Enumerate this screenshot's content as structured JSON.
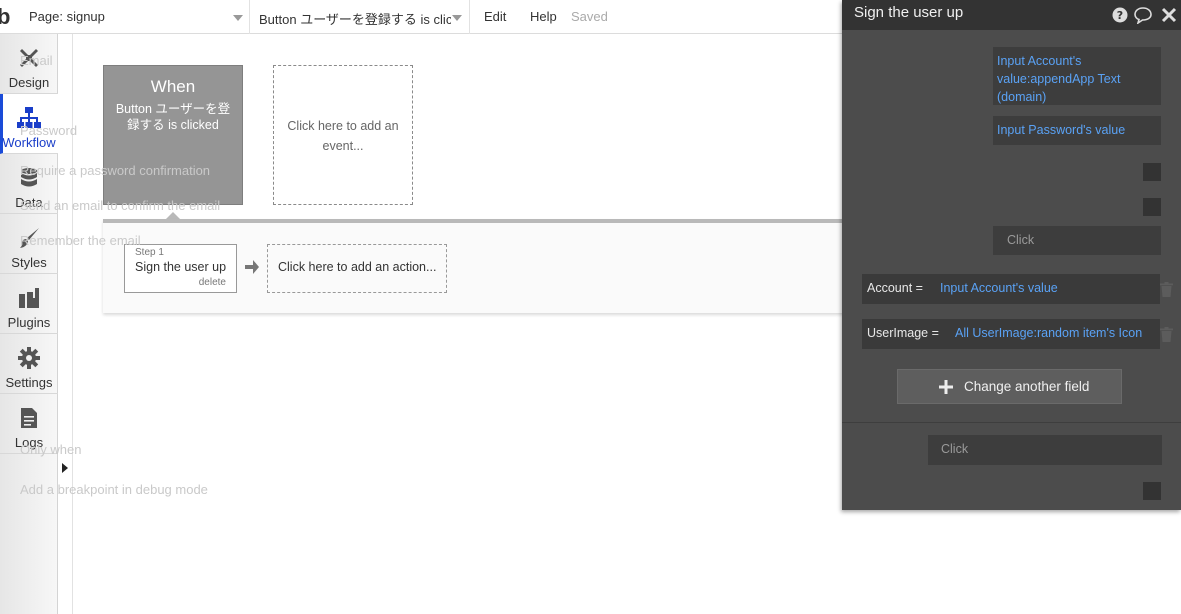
{
  "topbar": {
    "logo": "b",
    "page_label": "Page: signup",
    "event_label": "Button ユーザーを登録する is clic...",
    "menu_edit": "Edit",
    "menu_help": "Help",
    "status": "Saved"
  },
  "sidebar": {
    "items": [
      {
        "label": "Design",
        "icon": "design-tools-icon"
      },
      {
        "label": "Workflow",
        "icon": "workflow-icon"
      },
      {
        "label": "Data",
        "icon": "database-icon"
      },
      {
        "label": "Styles",
        "icon": "brush-icon"
      },
      {
        "label": "Plugins",
        "icon": "plugins-icon"
      },
      {
        "label": "Settings",
        "icon": "gear-icon"
      },
      {
        "label": "Logs",
        "icon": "document-icon"
      }
    ],
    "active_item": "Workflow",
    "active_color": "#1a3ec9"
  },
  "canvas": {
    "when_title": "When",
    "when_subtitle": "Button ユーザーを登録する is clicked",
    "add_event": "Click here to add an event...",
    "step_number": "Step 1",
    "step_name": "Sign the user up",
    "step_delete": "delete",
    "add_action": "Click here to add an action..."
  },
  "panel": {
    "title": "Sign the user up",
    "email_label": "Email",
    "email_value": "Input Account's value:appendApp Text (domain)",
    "password_label": "Password",
    "password_value": "Input Password's value",
    "require_confirm_label": "Require a password confirmation",
    "send_email_label": "Send an email to confirm the email",
    "remember_label": "Remember the email",
    "remember_placeholder": "Click",
    "fields": [
      {
        "key": "Account =",
        "value": "Input Account's value"
      },
      {
        "key": "UserImage =",
        "value": "All UserImage:random item's Icon"
      }
    ],
    "change_field_button": "Change another field",
    "only_when_label": "Only when",
    "only_when_placeholder": "Click",
    "breakpoint_label": "Add a breakpoint in debug mode",
    "value_color": "#5aa2f5"
  }
}
